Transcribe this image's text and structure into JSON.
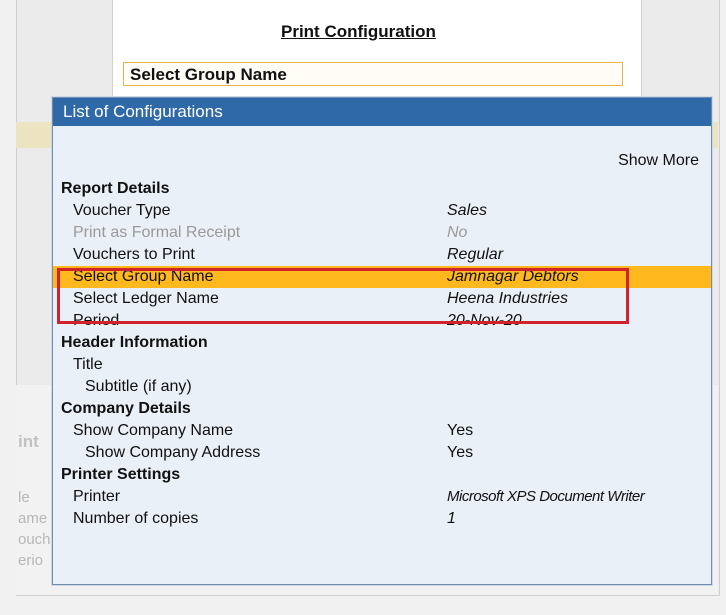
{
  "print_configuration": {
    "title": "Print Configuration",
    "field_label": "Select Group Name"
  },
  "popup": {
    "title": "List of Configurations",
    "show_more": "Show More"
  },
  "sections": {
    "report_details": "Report Details",
    "header_information": "Header Information",
    "company_details": "Company Details",
    "printer_settings": "Printer Settings"
  },
  "rows": {
    "voucher_type": {
      "label": "Voucher Type",
      "value": "Sales"
    },
    "print_formal_receipt": {
      "label": "Print as Formal Receipt",
      "value": "No"
    },
    "vouchers_to_print": {
      "label": "Vouchers to Print",
      "value": "Regular"
    },
    "select_group_name": {
      "label": "Select Group Name",
      "value": "Jamnagar Debtors"
    },
    "select_ledger_name": {
      "label": "Select Ledger Name",
      "value": "Heena Industries"
    },
    "period": {
      "label": "Period",
      "value": "20-Nov-20"
    },
    "title": {
      "label": "Title"
    },
    "subtitle": {
      "label": "Subtitle (if any)"
    },
    "show_company_name": {
      "label": "Show Company Name",
      "value": "Yes"
    },
    "show_company_address": {
      "label": "Show Company Address",
      "value": "Yes"
    },
    "printer": {
      "label": "Printer",
      "value": "Microsoft XPS Document Writer"
    },
    "number_of_copies": {
      "label": "Number of copies",
      "value": "1"
    }
  },
  "background": {
    "text_1": "int",
    "text_2": "le",
    "text_3": "ame",
    "text_4": "ouch",
    "text_5": "erio"
  },
  "colors": {
    "titlebar": "#3069a8",
    "highlight": "#ffb81e",
    "annotation_box": "#d0232b",
    "popup_bg": "#e9f0f7"
  }
}
